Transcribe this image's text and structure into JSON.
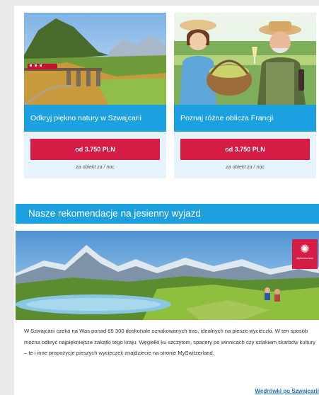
{
  "offers": [
    {
      "title": "Odkryj piękno natury w Szwajcarii",
      "price": "od 3.750 PLN",
      "note": "za obiekt za / noc"
    },
    {
      "title": "Poznaj różne oblicza Francji",
      "price": "od 3.750 PLN",
      "note": "za obiekt za / noc"
    }
  ],
  "section": {
    "banner": "Nasze rekomendacje na jesienny wyjazd",
    "logo_text": "MySwitzerland",
    "description": "W Szwajcarii czeka na Was ponad 65 300 doskonale oznakowanych tras, idealnych na piesze wycieczki. W ten sposób można odkryć najpiękniejsze zakątki tego kraju. Węgiełki ku szczytom, spacery po winnicach czy szlakiem skarbów kultury – te i inne propozycje pieszych wycieczek znajdziecie na stronie MySwitzerland.",
    "link": "Wędrówki po Szwajcarii"
  },
  "colors": {
    "accent_blue": "#1da0e0",
    "cta_red": "#d51c45",
    "card_bg": "#e6f3fb"
  },
  "icons": {
    "logo": "sun-icon"
  }
}
